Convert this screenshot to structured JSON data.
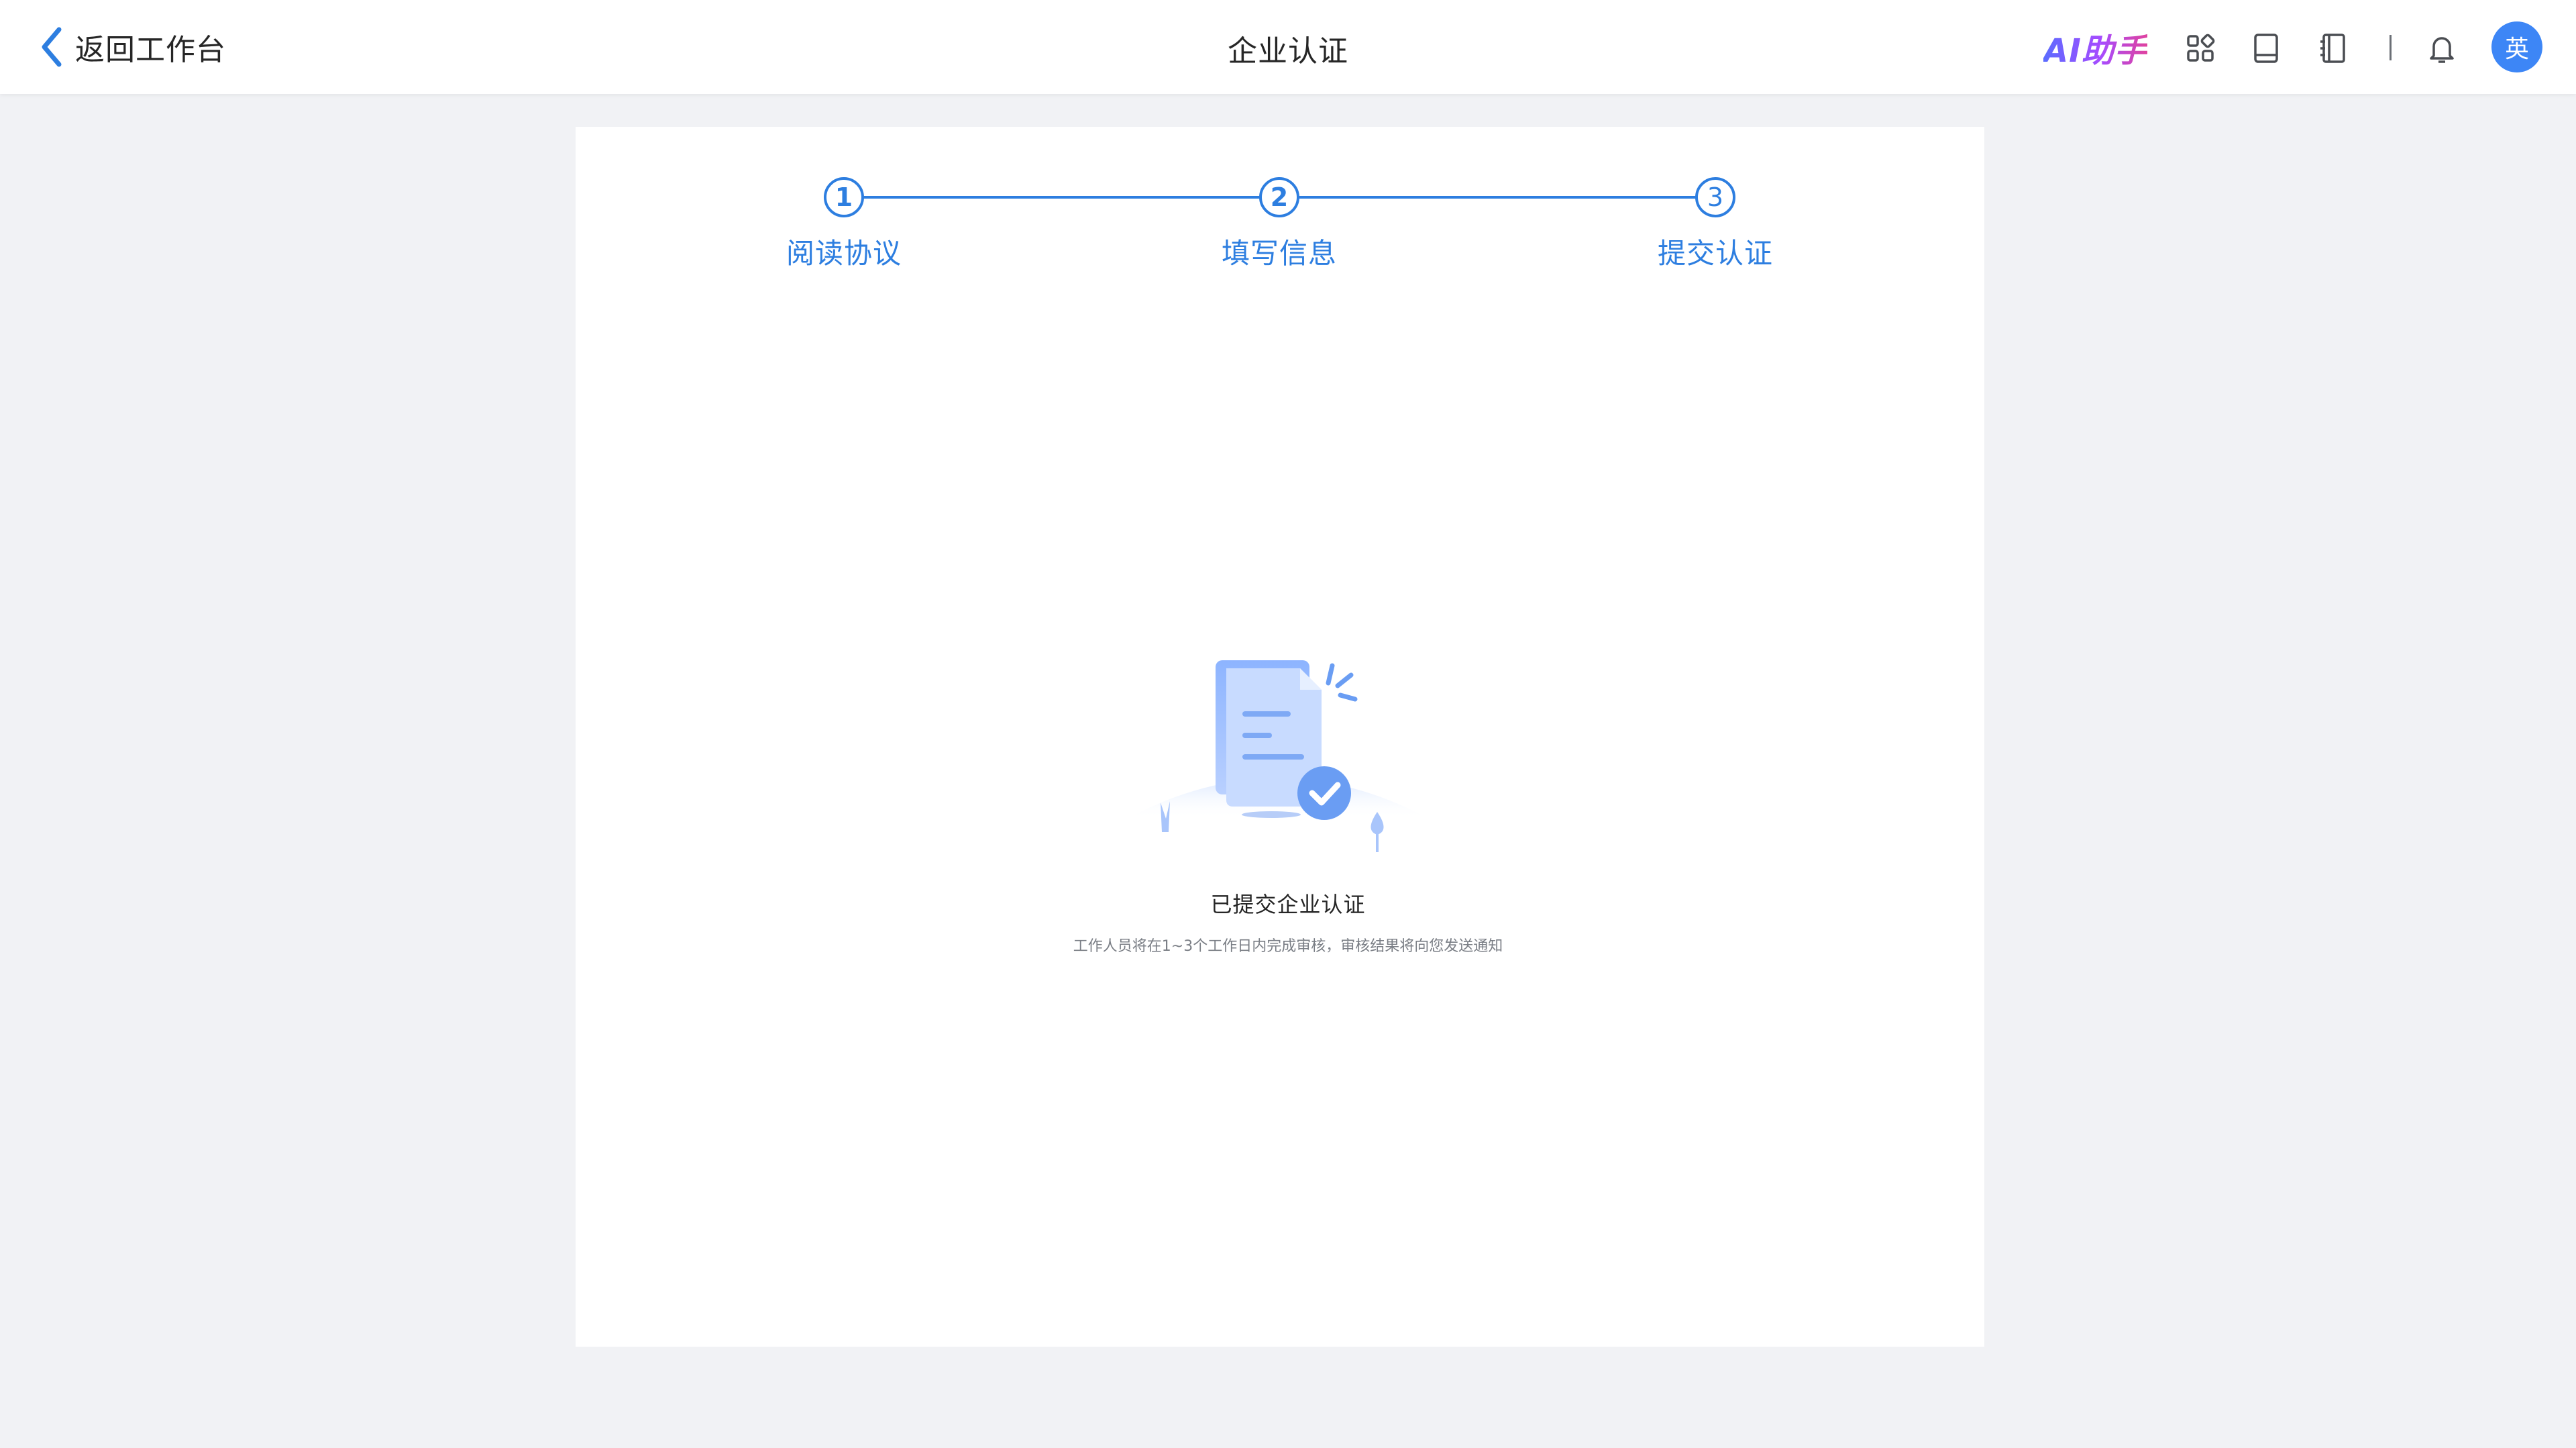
{
  "header": {
    "back_label": "返回工作台",
    "title": "企业认证",
    "ai_assistant": "AI助手",
    "avatar_text": "英",
    "icons": [
      "apps-icon",
      "book-icon",
      "notebook-icon",
      "bell-icon"
    ]
  },
  "steps": [
    {
      "number": "1",
      "label": "阅读协议"
    },
    {
      "number": "2",
      "label": "填写信息"
    },
    {
      "number": "3",
      "label": "提交认证"
    }
  ],
  "result": {
    "title": "已提交企业认证",
    "description": "工作人员将在1~3个工作日内完成审核，审核结果将向您发送通知"
  },
  "colors": {
    "accent": "#2d7ee0",
    "background": "#f1f2f5",
    "avatar": "#3d86f6"
  }
}
